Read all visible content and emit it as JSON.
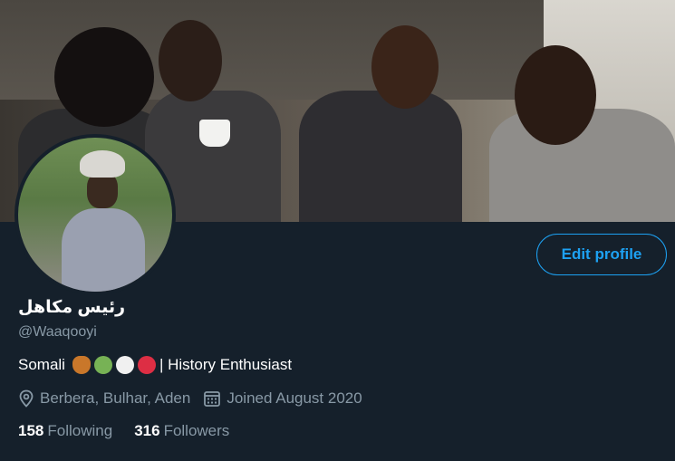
{
  "profile": {
    "display_name": "رئيس مكاهل",
    "handle": "@Waaqooyi",
    "bio_prefix": "Somali",
    "bio_emojis": [
      "owl-emoji",
      "green-heart-emoji",
      "white-heart-emoji",
      "red-heart-emoji"
    ],
    "bio_suffix": "| History Enthusiast",
    "location": "Berbera, Bulhar, Aden",
    "joined": "Joined August 2020"
  },
  "actions": {
    "edit_profile_label": "Edit profile"
  },
  "stats": {
    "following_count": "158",
    "following_label": "Following",
    "followers_count": "316",
    "followers_label": "Followers"
  },
  "colors": {
    "background": "#15202b",
    "accent": "#1da1f2",
    "secondary_text": "#8899a6",
    "primary_text": "#ffffff"
  }
}
